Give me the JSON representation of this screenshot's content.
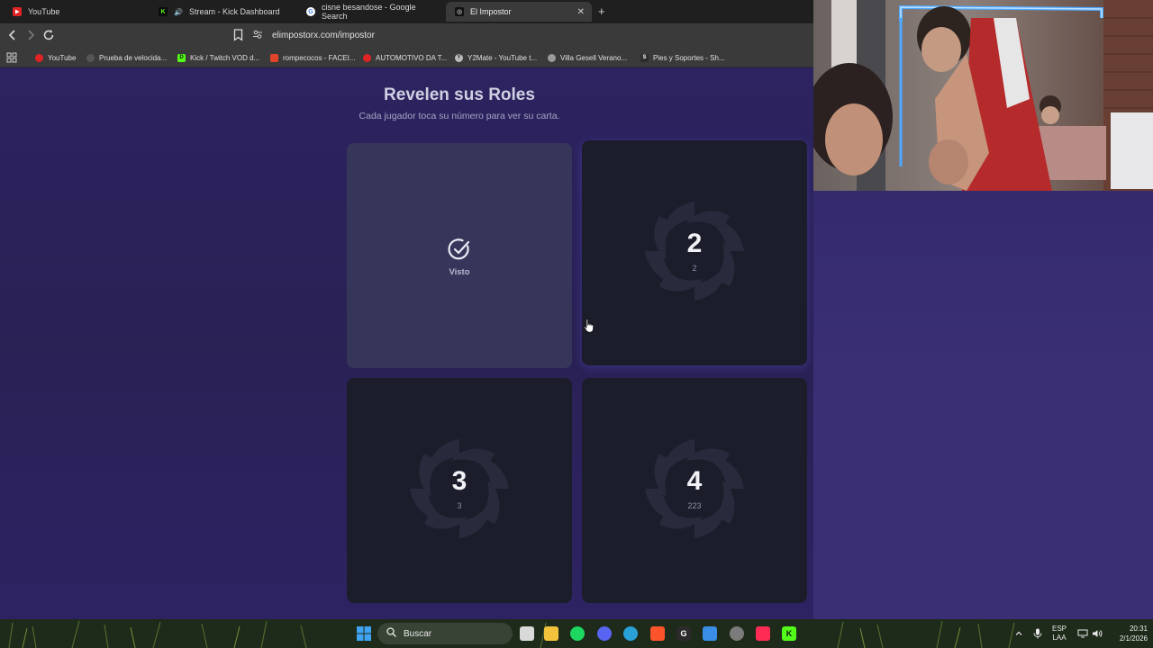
{
  "browser": {
    "tabs": [
      {
        "label": "YouTube",
        "icon": "youtube-icon",
        "color": "#e02424"
      },
      {
        "label": "Stream - Kick Dashboard",
        "icon": "kick-icon",
        "color": "#53fc18"
      },
      {
        "label": "cisne besandose - Google Search",
        "icon": "google-icon",
        "color": "#4285f4"
      },
      {
        "label": "El Impostor",
        "icon": "impostor-icon",
        "color": "#ffffff"
      }
    ],
    "url": "elimpostorx.com/impostor",
    "bookmarks": [
      {
        "label": "YouTube",
        "color": "#e02424"
      },
      {
        "label": "Prueba de velocida...",
        "color": "#555555"
      },
      {
        "label": "Kick / Twitch VOD d...",
        "color": "#53fc18"
      },
      {
        "label": "rompecocos - FACEI...",
        "color": "#e0452a"
      },
      {
        "label": "AUTOMOTIVO DA T...",
        "color": "#e02424"
      },
      {
        "label": "Y2Mate - YouTube t...",
        "color": "#bbbbbb"
      },
      {
        "label": "Villa Gesell Verano...",
        "color": "#9a9a9a"
      },
      {
        "label": "Pies y Soportes - Sh...",
        "color": "#2d2d2d"
      }
    ]
  },
  "game": {
    "title": "Revelen sus Roles",
    "subtitle": "Cada jugador toca su número para ver su carta.",
    "cards": [
      {
        "state": "seen",
        "label": "Visto"
      },
      {
        "state": "hidden",
        "number": "2",
        "sub": "2"
      },
      {
        "state": "hidden",
        "number": "3",
        "sub": "3"
      },
      {
        "state": "hidden",
        "number": "4",
        "sub": "223"
      }
    ]
  },
  "taskbar": {
    "search_placeholder": "Buscar",
    "language": "ESP",
    "layout": "LAA",
    "time": "20:31",
    "date": "2/1/2026"
  },
  "colors": {
    "page_bg": "#2a2155",
    "card_bg": "#1b1d2b",
    "card_seen_bg": "#353659"
  }
}
